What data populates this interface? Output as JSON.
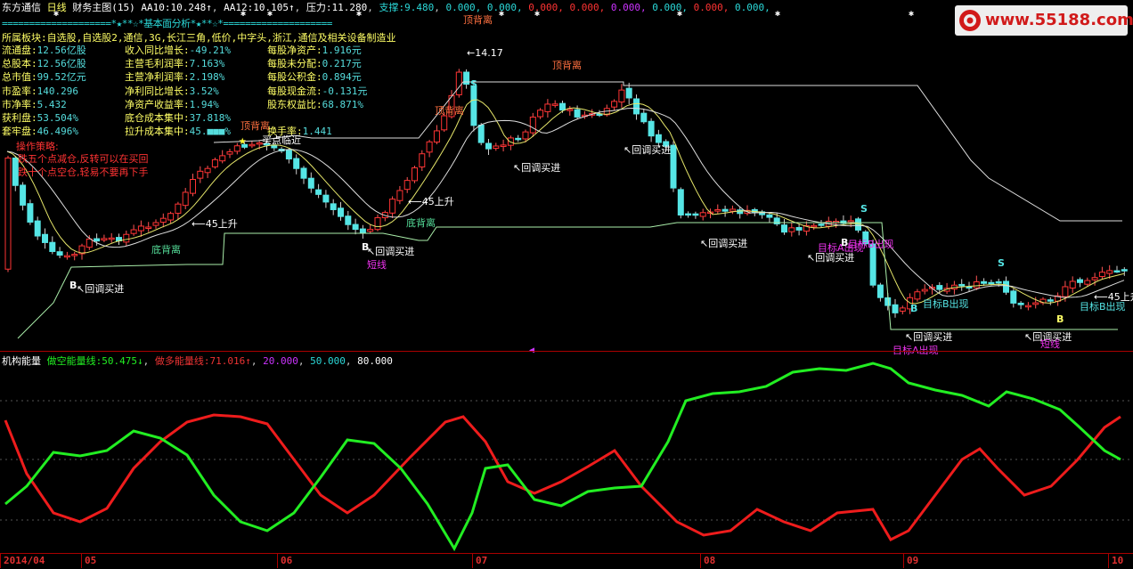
{
  "header": {
    "stock_name": "东方通信",
    "period": "日线",
    "formula": "财务主图(15)",
    "aa10_label": "AA10:",
    "aa10_value": "10.248↑",
    "aa12_label": "AA12:",
    "aa12_value": "10.105↑",
    "pressure_label": "压力:",
    "pressure_value": "11.280",
    "support_label": "支撑:",
    "support_value": "9.480",
    "extra_values": [
      {
        "text": "0.000",
        "color": "#2bd9d9"
      },
      {
        "text": "0.000",
        "color": "#2bd9d9"
      },
      {
        "text": "0.000",
        "color": "#ff3333"
      },
      {
        "text": "0.000",
        "color": "#ff3333"
      },
      {
        "text": "0.000",
        "color": "#cc33ff"
      },
      {
        "text": "0.000",
        "color": "#2bd9d9"
      },
      {
        "text": "0.000",
        "color": "#ff3333"
      },
      {
        "text": "0.000",
        "color": "#2bd9d9"
      }
    ]
  },
  "separator_line": "====================*★**☆*基本面分析*★**☆*====================",
  "separator_line2": "==================================================",
  "sector": "所属板块:自选股,自选股2,通信,3G,长江三角,低价,中字头,浙江,通信及相关设备制造业",
  "fundamentals": [
    [
      {
        "label": "流通盘:",
        "value": "12.56亿股"
      },
      {
        "label": "收入同比增长:",
        "value": "-49.21%"
      },
      {
        "label": "每股净资产:",
        "value": "1.916元"
      }
    ],
    [
      {
        "label": "总股本:",
        "value": "12.56亿股"
      },
      {
        "label": "主营毛利润率:",
        "value": "7.163%"
      },
      {
        "label": "每股未分配:",
        "value": "0.217元"
      }
    ],
    [
      {
        "label": "总市值:",
        "value": "99.52亿元"
      },
      {
        "label": "主营净利润率:",
        "value": "2.198%"
      },
      {
        "label": "每股公积金:",
        "value": "0.894元"
      }
    ],
    [
      {
        "label": "市盈率:",
        "value": "140.296"
      },
      {
        "label": "净利同比增长:",
        "value": "3.52%"
      },
      {
        "label": "每股现金流:",
        "value": "-0.131元"
      }
    ],
    [
      {
        "label": "市净率:",
        "value": "5.432"
      },
      {
        "label": "净资产收益率:",
        "value": "1.94%"
      },
      {
        "label": "股东权益比:",
        "value": "68.871%"
      }
    ],
    [
      {
        "label": "获利盘:",
        "value": "53.504%"
      },
      {
        "label": "底仓成本集中:",
        "value": "37.818%"
      },
      {
        "label": "",
        "value": ""
      }
    ],
    [
      {
        "label": "套牢盘:",
        "value": "46.496%"
      },
      {
        "label": "拉升成本集中:",
        "value": "45.■■■%"
      },
      {
        "label": "换手率:",
        "value": "1.441"
      }
    ]
  ],
  "advice": {
    "title": "操作策略:",
    "line1": "跌五个点减仓,反转可以在买回",
    "line2": "跌十个点空仓,轻易不要再下手"
  },
  "annotations": {
    "top_divergence": "顶背离",
    "bottom_divergence": "底背离",
    "pullback_buy": "回调买进",
    "rise_45": "45上升",
    "short_line": "短线",
    "target_b": "目标B出现",
    "target_a": "目标A出现",
    "signal_b": "B",
    "signal_s": "S",
    "peak_price": "14.17",
    "buy_dot": "买点临近",
    "lower_header_title": "机构能量"
  },
  "indicator": {
    "name": "机构能量",
    "short_label": "做空能量线:",
    "short_value": "50.475↓",
    "long_label": "做多能量线:",
    "long_value": "71.016↑",
    "level1": "20.000",
    "level2": "50.000",
    "level3": "80.000"
  },
  "x_axis": [
    "2014/04",
    "05",
    "06",
    "07",
    "08",
    "09",
    "10"
  ],
  "watermark": "www.55188.com",
  "colors": {
    "up": "#ff3333",
    "down": "#55e5e5",
    "ma_yellow": "#e6e66a",
    "ma_white": "#dddddd",
    "support": "#aaeeaa",
    "energy_red": "#ee1c1c",
    "energy_green": "#22ee22"
  }
}
